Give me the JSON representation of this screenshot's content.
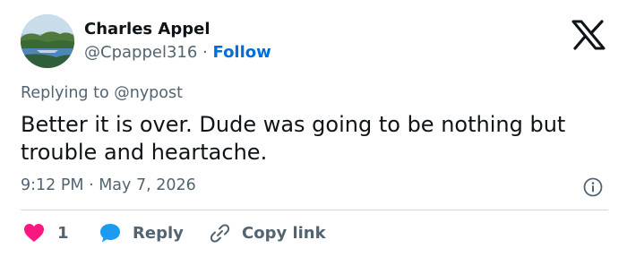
{
  "author": {
    "display_name": "Charles Appel",
    "handle": "@Cpappel316",
    "separator": "·",
    "follow_label": "Follow"
  },
  "tweet": {
    "replying_to": "Replying to @nypost",
    "text": "Better it is over. Dude was going to be nothing but trouble and heartache.",
    "time": "9:12 PM",
    "date": "May 7, 2026",
    "timestamp": "9:12 PM · May 7, 2026"
  },
  "actions": {
    "like_count": "1",
    "reply_label": "Reply",
    "copy_link_label": "Copy link"
  },
  "icons": {
    "brand": "x-logo-icon",
    "info": "info-icon",
    "like": "heart-icon",
    "reply": "speech-bubble-icon",
    "copy": "link-icon"
  },
  "colors": {
    "text_primary": "#0f1419",
    "text_secondary": "#536471",
    "follow_blue": "#006fd6",
    "like_red": "#f91880",
    "reply_blue": "#1d9bf0",
    "divider": "#cfd9de"
  }
}
